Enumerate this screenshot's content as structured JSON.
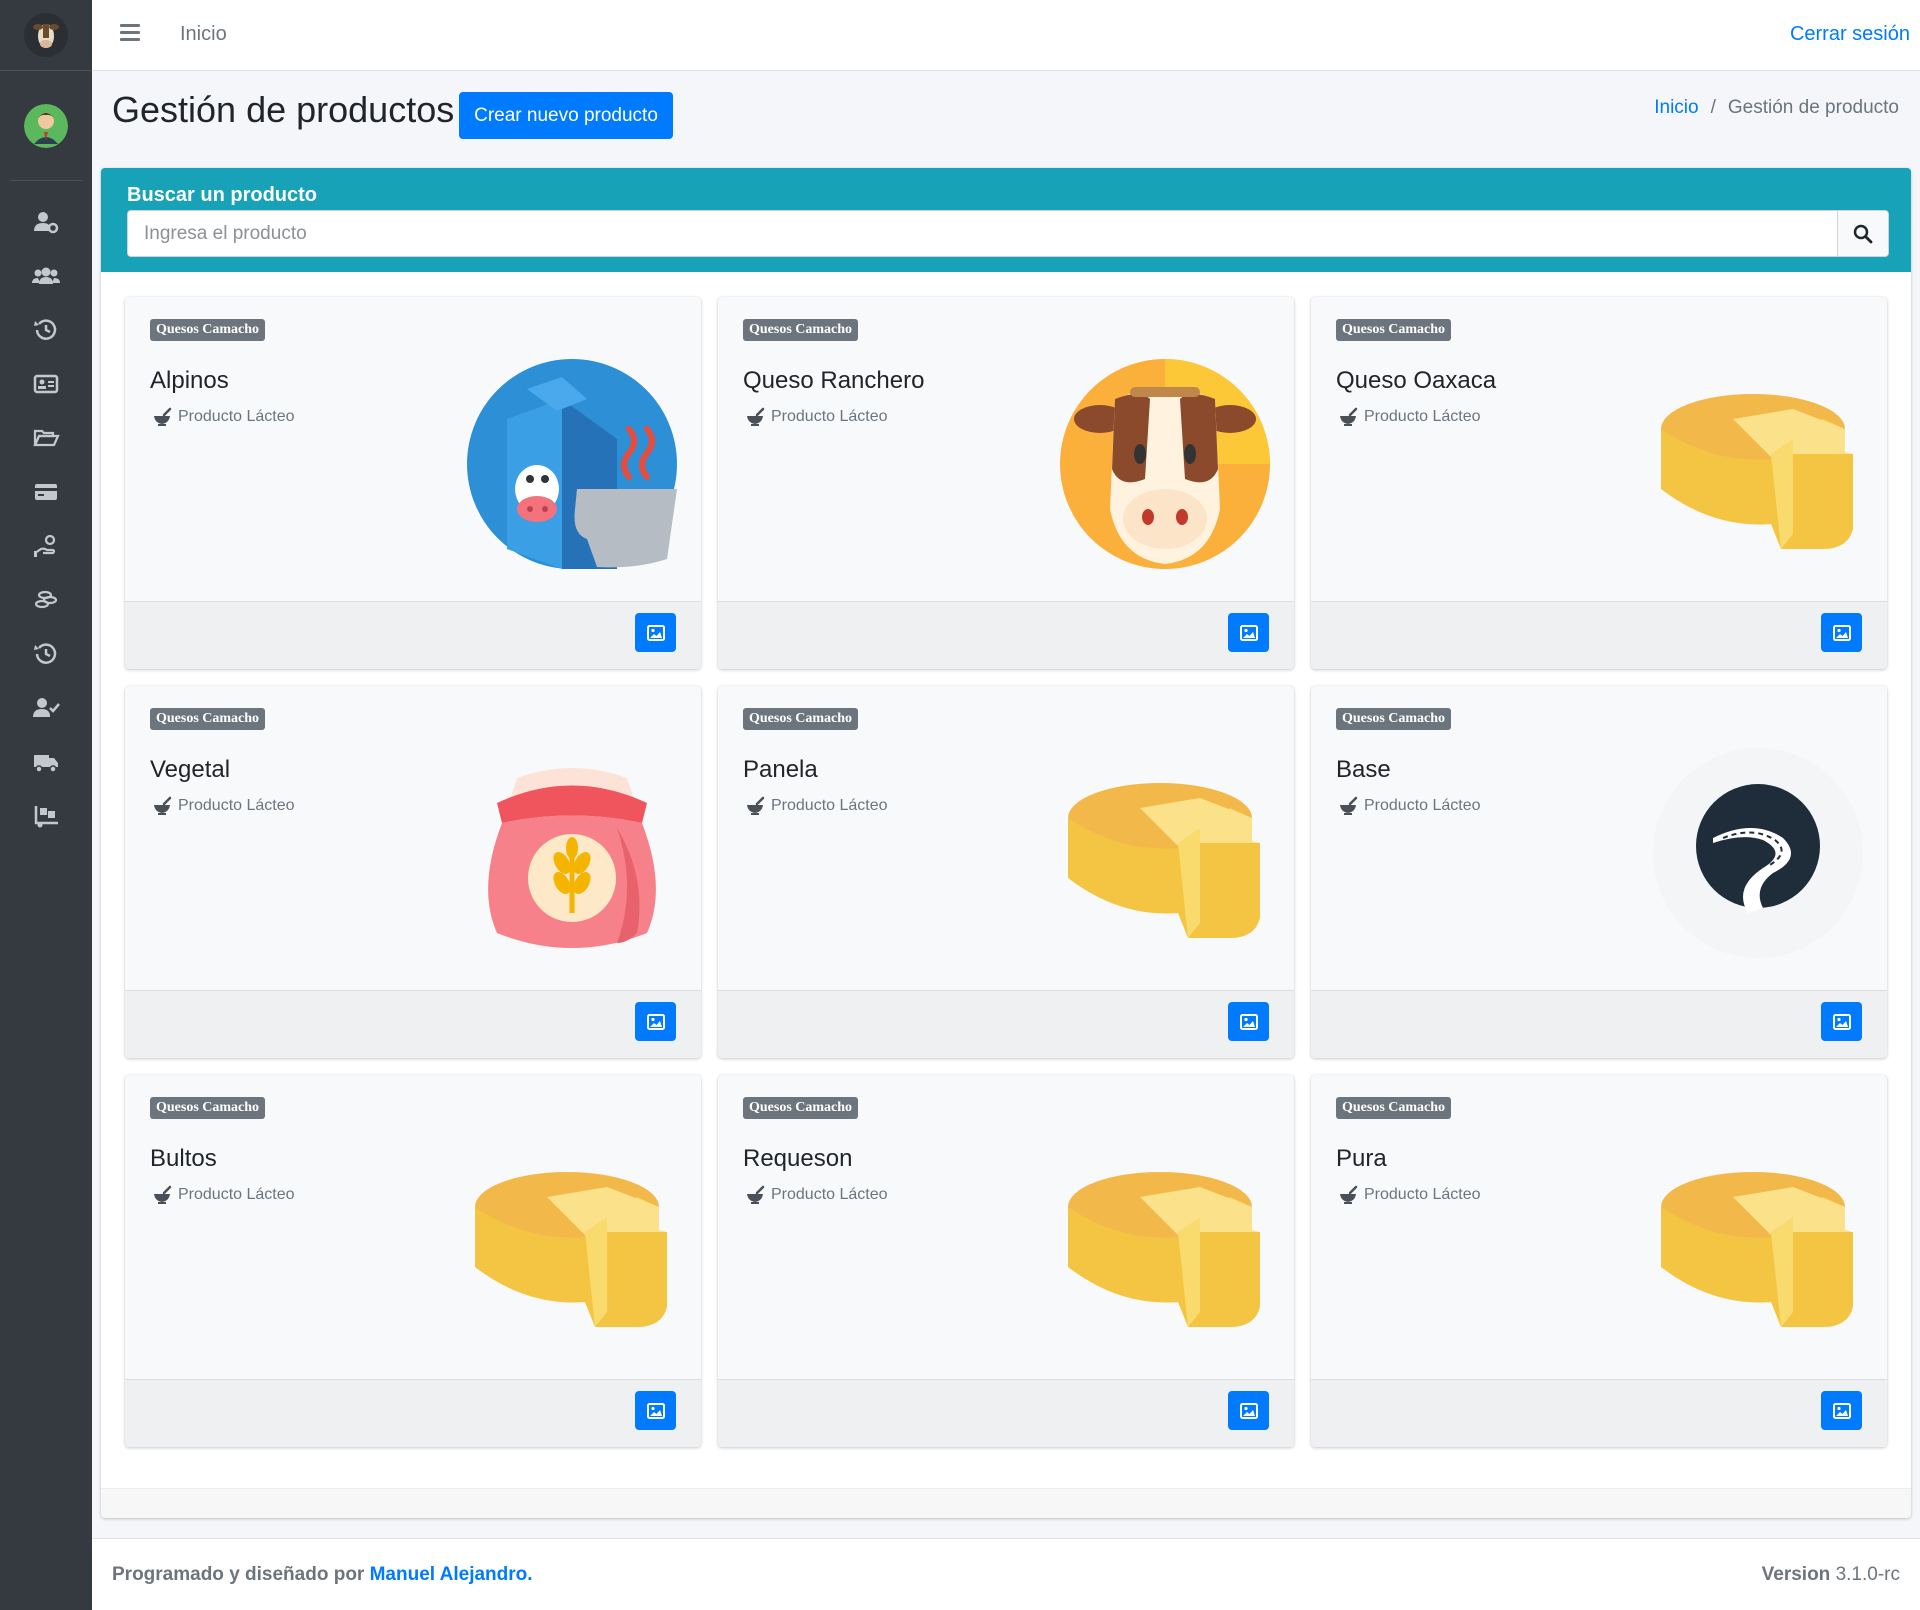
{
  "topbar": {
    "home_link": "Inicio",
    "logout": "Cerrar sesión"
  },
  "header": {
    "title": "Gestión de productos",
    "create_button": "Crear nuevo producto",
    "breadcrumb": {
      "home": "Inicio",
      "separator": "/",
      "current": "Gestión de producto"
    }
  },
  "search": {
    "title": "Buscar un producto",
    "placeholder": "Ingresa el producto"
  },
  "sidebar": {
    "icons": [
      "user-cog-icon",
      "users-icon",
      "history-icon",
      "id-card-icon",
      "folder-open-icon",
      "credit-card-icon",
      "hand-holding-usd-icon",
      "coins-icon",
      "history-icon",
      "user-check-icon",
      "truck-icon",
      "truck-loading-icon"
    ]
  },
  "products": [
    {
      "badge": "Quesos Camacho",
      "name": "Alpinos",
      "category": "Producto Lácteo",
      "image": "milk-carton"
    },
    {
      "badge": "Quesos Camacho",
      "name": "Queso Ranchero",
      "category": "Producto Lácteo",
      "image": "cow"
    },
    {
      "badge": "Quesos Camacho",
      "name": "Queso Oaxaca",
      "category": "Producto Lácteo",
      "image": "cheese"
    },
    {
      "badge": "Quesos Camacho",
      "name": "Vegetal",
      "category": "Producto Lácteo",
      "image": "flour-sack"
    },
    {
      "badge": "Quesos Camacho",
      "name": "Panela",
      "category": "Producto Lácteo",
      "image": "cheese"
    },
    {
      "badge": "Quesos Camacho",
      "name": "Base",
      "category": "Producto Lácteo",
      "image": "road"
    },
    {
      "badge": "Quesos Camacho",
      "name": "Bultos",
      "category": "Producto Lácteo",
      "image": "cheese"
    },
    {
      "badge": "Quesos Camacho",
      "name": "Requeson",
      "category": "Producto Lácteo",
      "image": "cheese"
    },
    {
      "badge": "Quesos Camacho",
      "name": "Pura",
      "category": "Producto Lácteo",
      "image": "cheese"
    }
  ],
  "footer": {
    "credit_prefix": "Programado y diseñado por",
    "author": "Manuel Alejandro.",
    "version_label": "Version",
    "version": "3.1.0-rc"
  },
  "colors": {
    "primary": "#007bff",
    "info": "#17a2b8",
    "sidebar": "#343a40",
    "badge": "#6c757d"
  }
}
